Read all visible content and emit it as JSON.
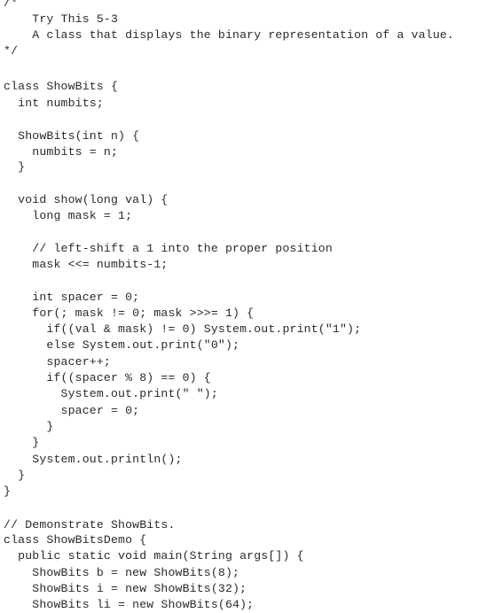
{
  "code": {
    "lines": [
      "/*",
      "    Try This 5-3",
      "    A class that displays the binary representation of a value.",
      "*/",
      "",
      "class ShowBits {",
      "  int numbits;",
      "",
      "  ShowBits(int n) {",
      "    numbits = n;",
      "  }",
      "",
      "  void show(long val) {",
      "    long mask = 1;",
      "",
      "    // left-shift a 1 into the proper position",
      "    mask <<= numbits-1;",
      "",
      "    int spacer = 0;",
      "    for(; mask != 0; mask >>>= 1) {",
      "      if((val & mask) != 0) System.out.print(\"1\");",
      "      else System.out.print(\"0\");",
      "      spacer++;",
      "      if((spacer % 8) == 0) {",
      "        System.out.print(\" \");",
      "        spacer = 0;",
      "      }",
      "    }",
      "    System.out.println();",
      "  }",
      "}",
      "",
      "// Demonstrate ShowBits.",
      "class ShowBitsDemo {",
      "  public static void main(String args[]) {",
      "    ShowBits b = new ShowBits(8);",
      "    ShowBits i = new ShowBits(32);",
      "    ShowBits li = new ShowBits(64);"
    ]
  }
}
